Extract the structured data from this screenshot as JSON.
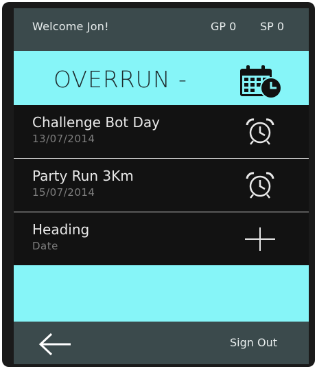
{
  "header": {
    "welcome": "Welcome Jon!",
    "gp": "GP 0",
    "sp": "SP 0"
  },
  "hero": {
    "title": "OVERRUN -",
    "icon": "calendar-clock-icon"
  },
  "events": [
    {
      "title": "Challenge Bot Day",
      "date": "13/07/2014",
      "icon": "alarm-clock-icon"
    },
    {
      "title": "Party Run 3Km",
      "date": "15/07/2014",
      "icon": "alarm-clock-icon"
    },
    {
      "title": "Heading",
      "date": "Date",
      "icon": "plus-icon"
    }
  ],
  "footer": {
    "back_icon": "back-arrow-icon",
    "sign_out": "Sign Out"
  },
  "colors": {
    "bar": "#3b4a4c",
    "accent": "#86f5f8",
    "list": "#121212"
  }
}
